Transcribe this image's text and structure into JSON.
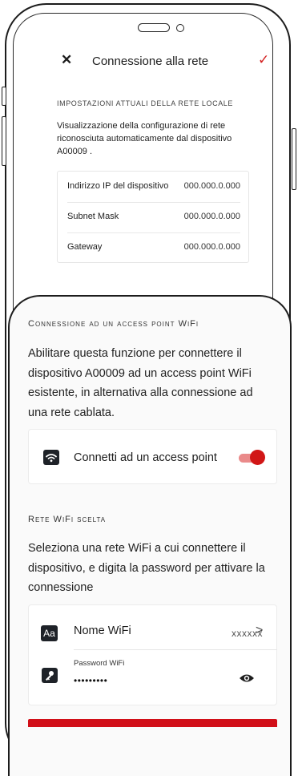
{
  "header": {
    "close_icon": "close-icon",
    "title": "Connessione alla rete",
    "confirm_icon": "check-icon"
  },
  "lan": {
    "section_label": "Impostazioni attuali della rete locale",
    "description": "Visualizzazione della configurazione di rete riconosciuta automaticamente dal dispositivo A00009 .",
    "rows": [
      {
        "label": "Indirizzo IP del dispositivo",
        "value": "000.000.0.000"
      },
      {
        "label": "Subnet Mask",
        "value": "000.000.0.000"
      },
      {
        "label": "Gateway",
        "value": "000.000.0.000"
      }
    ]
  },
  "wifi": {
    "section_label": "Connessione ad un access point WiFi",
    "description": "Abilitare questa funzione per connettere il dispositivo A00009 ad un access point WiFi esistente, in alternativa alla connessione ad una rete cablata.",
    "toggle_label": "Connetti ad un access point",
    "toggle_on": true,
    "accent": "#d11616"
  },
  "chosen": {
    "section_label": "Rete WiFi scelta",
    "description": "Seleziona una rete WiFi a cui connettere il dispositivo, e digita la password per attivare la connessione",
    "name_label": "Nome WiFi",
    "name_value": "xxxxxx",
    "chevron": ">",
    "aa_text": "Aa",
    "password_label": "Password WiFi",
    "password_value": "•••••••••"
  }
}
